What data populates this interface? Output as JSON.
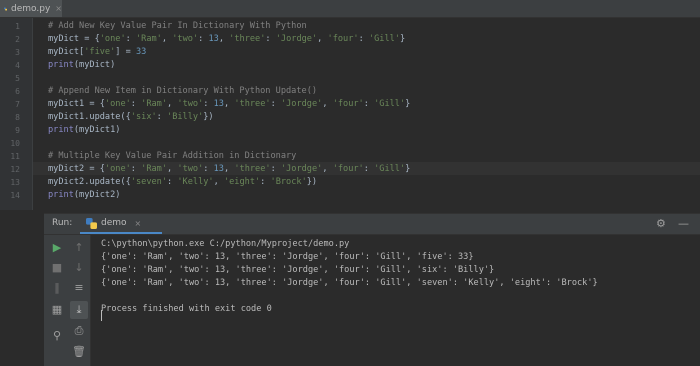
{
  "file_tab": {
    "name": "demo.py",
    "close": "×"
  },
  "editor": {
    "line_numbers": [
      "1",
      "2",
      "3",
      "4",
      "5",
      "6",
      "7",
      "8",
      "9",
      "10",
      "11",
      "12",
      "13",
      "14"
    ],
    "lines": [
      [
        {
          "t": "# Add New Key Value Pair In Dictionary With Python",
          "c": "cmt"
        }
      ],
      [
        {
          "t": "myDict",
          "c": "var"
        },
        {
          "t": " = {",
          "c": "var"
        },
        {
          "t": "'one'",
          "c": "str"
        },
        {
          "t": ": ",
          "c": "var"
        },
        {
          "t": "'Ram'",
          "c": "str"
        },
        {
          "t": ", ",
          "c": "var"
        },
        {
          "t": "'two'",
          "c": "str"
        },
        {
          "t": ": ",
          "c": "var"
        },
        {
          "t": "13",
          "c": "num"
        },
        {
          "t": ", ",
          "c": "var"
        },
        {
          "t": "'three'",
          "c": "str"
        },
        {
          "t": ": ",
          "c": "var"
        },
        {
          "t": "'Jordge'",
          "c": "str"
        },
        {
          "t": ", ",
          "c": "var"
        },
        {
          "t": "'four'",
          "c": "str"
        },
        {
          "t": ": ",
          "c": "var"
        },
        {
          "t": "'Gill'",
          "c": "str"
        },
        {
          "t": "}",
          "c": "var"
        }
      ],
      [
        {
          "t": "myDict[",
          "c": "var"
        },
        {
          "t": "'five'",
          "c": "str"
        },
        {
          "t": "] = ",
          "c": "var"
        },
        {
          "t": "33",
          "c": "num"
        }
      ],
      [
        {
          "t": "print",
          "c": "fn"
        },
        {
          "t": "(myDict)",
          "c": "var"
        }
      ],
      [],
      [
        {
          "t": "# Append New Item in Dictionary With Python Update()",
          "c": "cmt"
        }
      ],
      [
        {
          "t": "myDict1 = {",
          "c": "var"
        },
        {
          "t": "'one'",
          "c": "str"
        },
        {
          "t": ": ",
          "c": "var"
        },
        {
          "t": "'Ram'",
          "c": "str"
        },
        {
          "t": ", ",
          "c": "var"
        },
        {
          "t": "'two'",
          "c": "str"
        },
        {
          "t": ": ",
          "c": "var"
        },
        {
          "t": "13",
          "c": "num"
        },
        {
          "t": ", ",
          "c": "var"
        },
        {
          "t": "'three'",
          "c": "str"
        },
        {
          "t": ": ",
          "c": "var"
        },
        {
          "t": "'Jordge'",
          "c": "str"
        },
        {
          "t": ", ",
          "c": "var"
        },
        {
          "t": "'four'",
          "c": "str"
        },
        {
          "t": ": ",
          "c": "var"
        },
        {
          "t": "'Gill'",
          "c": "str"
        },
        {
          "t": "}",
          "c": "var"
        }
      ],
      [
        {
          "t": "myDict1.update({",
          "c": "var"
        },
        {
          "t": "'six'",
          "c": "str"
        },
        {
          "t": ": ",
          "c": "var"
        },
        {
          "t": "'Billy'",
          "c": "str"
        },
        {
          "t": "})",
          "c": "var"
        }
      ],
      [
        {
          "t": "print",
          "c": "fn"
        },
        {
          "t": "(myDict1)",
          "c": "var"
        }
      ],
      [],
      [
        {
          "t": "# Multiple Key Value Pair Addition in Dictionary",
          "c": "cmt"
        }
      ],
      [
        {
          "t": "myDict2 = {",
          "c": "var"
        },
        {
          "t": "'one'",
          "c": "str"
        },
        {
          "t": ": ",
          "c": "var"
        },
        {
          "t": "'Ram'",
          "c": "str"
        },
        {
          "t": ", ",
          "c": "var"
        },
        {
          "t": "'two'",
          "c": "str"
        },
        {
          "t": ": ",
          "c": "var"
        },
        {
          "t": "13",
          "c": "num"
        },
        {
          "t": ", ",
          "c": "var"
        },
        {
          "t": "'three'",
          "c": "str"
        },
        {
          "t": ": ",
          "c": "var"
        },
        {
          "t": "'Jordge'",
          "c": "str"
        },
        {
          "t": ", ",
          "c": "var"
        },
        {
          "t": "'four'",
          "c": "str"
        },
        {
          "t": ": ",
          "c": "var"
        },
        {
          "t": "'Gill'",
          "c": "str"
        },
        {
          "t": "}",
          "c": "var"
        }
      ],
      [
        {
          "t": "myDict2.update({",
          "c": "var"
        },
        {
          "t": "'seven'",
          "c": "str"
        },
        {
          "t": ": ",
          "c": "var"
        },
        {
          "t": "'Kelly'",
          "c": "str"
        },
        {
          "t": ", ",
          "c": "var"
        },
        {
          "t": "'eight'",
          "c": "str"
        },
        {
          "t": ": ",
          "c": "var"
        },
        {
          "t": "'Brock'",
          "c": "str"
        },
        {
          "t": "})",
          "c": "var"
        }
      ],
      [
        {
          "t": "print",
          "c": "fn"
        },
        {
          "t": "(myDict2)",
          "c": "var"
        }
      ]
    ]
  },
  "run_panel": {
    "label": "Run:",
    "tab_name": "demo",
    "tab_close": "×",
    "console_lines": [
      "C:\\python\\python.exe C:/python/Myproject/demo.py",
      "{'one': 'Ram', 'two': 13, 'three': 'Jordge', 'four': 'Gill', 'five': 33}",
      "{'one': 'Ram', 'two': 13, 'three': 'Jordge', 'four': 'Gill', 'six': 'Billy'}",
      "{'one': 'Ram', 'two': 13, 'three': 'Jordge', 'four': 'Gill', 'seven': 'Kelly', 'eight': 'Brock'}",
      "",
      "Process finished with exit code 0"
    ]
  },
  "icons": {
    "settings": "gear-icon",
    "minimize": "minimize-icon",
    "run": "play-icon",
    "stop": "stop-icon",
    "pause": "pause-icon",
    "layout": "layout-icon",
    "pin": "pin-icon",
    "up": "arrow-up-icon",
    "down": "arrow-down-icon",
    "wrap": "soft-wrap-icon",
    "scroll_end": "scroll-to-end-icon",
    "print": "print-icon",
    "trash": "trash-icon"
  },
  "colors": {
    "accent": "#4a88c7",
    "run_green": "#59a869"
  }
}
